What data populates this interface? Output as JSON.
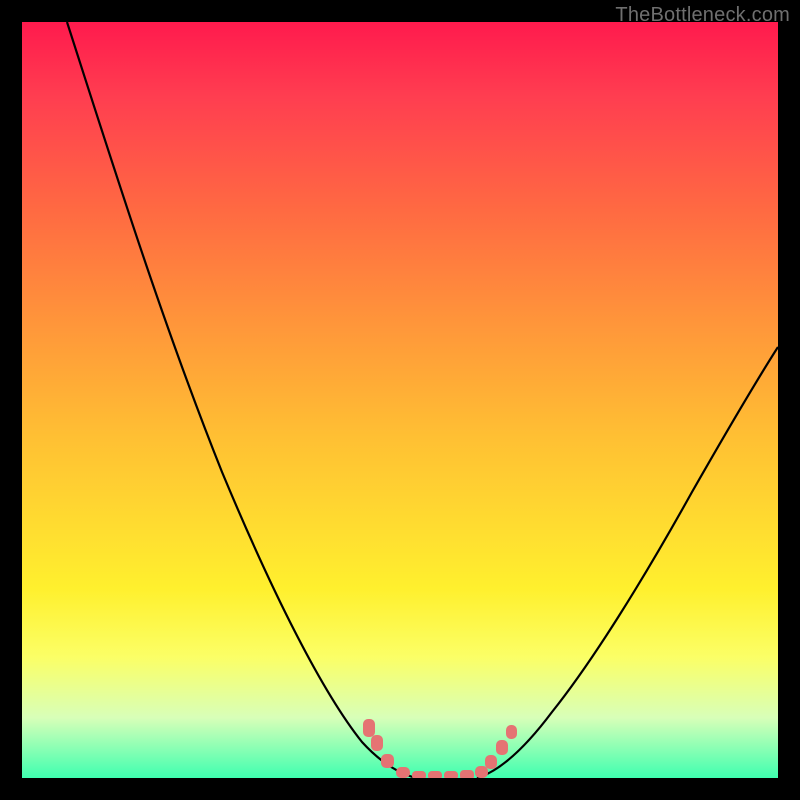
{
  "watermark": "TheBottleneck.com",
  "chart_data": {
    "type": "line",
    "title": "",
    "xlabel": "",
    "ylabel": "",
    "xlim": [
      0,
      100
    ],
    "ylim": [
      0,
      100
    ],
    "series": [
      {
        "name": "left-curve",
        "x": [
          6,
          10,
          15,
          20,
          25,
          30,
          35,
          40,
          45,
          48,
          50,
          52
        ],
        "values": [
          100,
          88,
          73,
          59,
          46,
          34,
          23,
          14,
          6,
          3,
          1,
          0
        ]
      },
      {
        "name": "right-curve",
        "x": [
          60,
          63,
          66,
          70,
          75,
          80,
          85,
          90,
          95,
          100
        ],
        "values": [
          0,
          2,
          4,
          8,
          14,
          22,
          31,
          40,
          49,
          57
        ]
      }
    ],
    "markers": {
      "name": "bottleneck-range",
      "x": [
        45.5,
        46.5,
        48,
        50,
        52,
        54,
        56,
        58,
        60,
        61,
        62.5,
        63.8
      ],
      "values": [
        7,
        5,
        2.5,
        0.8,
        0.5,
        0.5,
        0.5,
        0.5,
        0.8,
        2,
        4,
        6.5
      ]
    },
    "gradient_stops": [
      {
        "pos": 0,
        "color": "#ff1a4d"
      },
      {
        "pos": 25,
        "color": "#ff6a42"
      },
      {
        "pos": 55,
        "color": "#ffc033"
      },
      {
        "pos": 75,
        "color": "#fff02e"
      },
      {
        "pos": 100,
        "color": "#3fffb0"
      }
    ]
  }
}
